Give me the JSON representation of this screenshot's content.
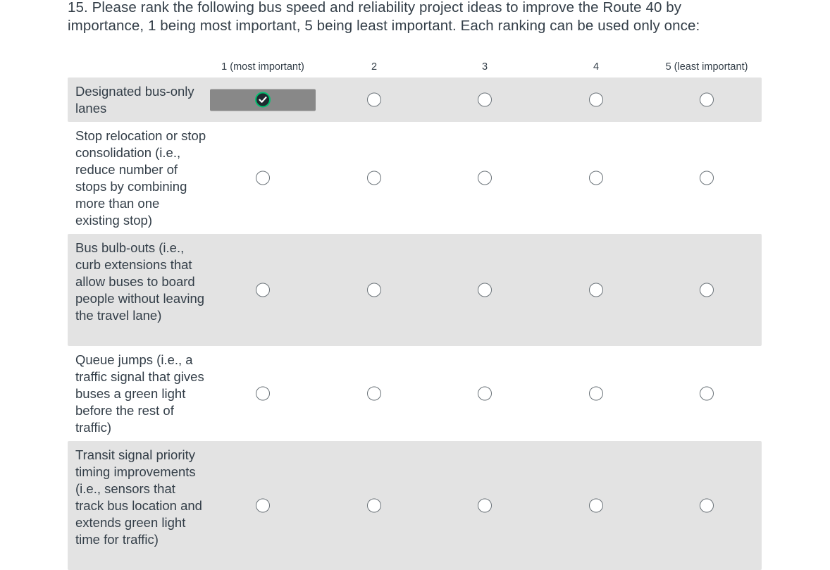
{
  "question": {
    "title": "15. Please rank the following bus speed and reliability project ideas to improve the Route 40 by importance, 1 being most important, 5 being least important. Each ranking can be used only once:"
  },
  "columns": [
    {
      "label": "1 (most important)"
    },
    {
      "label": "2"
    },
    {
      "label": "3"
    },
    {
      "label": "4"
    },
    {
      "label": "5 (least important)"
    }
  ],
  "rows": [
    {
      "label": "Designated bus-only lanes",
      "selected_rank": 1
    },
    {
      "label": "Stop relocation or stop consolidation (i.e., reduce number of stops by combining more than one existing stop)",
      "selected_rank": null
    },
    {
      "label": "Bus bulb-outs (i.e., curb extensions that allow buses to board people without leaving the travel lane)",
      "selected_rank": null
    },
    {
      "label": "Queue jumps (i.e., a traffic signal that gives buses a green light before the rest of traffic)",
      "selected_rank": null
    },
    {
      "label": "Transit signal priority timing improvements (i.e., sensors that track bus location and extends green light time for traffic)",
      "selected_rank": null
    }
  ],
  "colors": {
    "selected_cell": "#888888",
    "check_ring": "#00bf6f",
    "row_shade": "#e3e3e3"
  },
  "icons": {
    "selected": "checkmark-icon",
    "unselected": "radio-empty-icon"
  }
}
